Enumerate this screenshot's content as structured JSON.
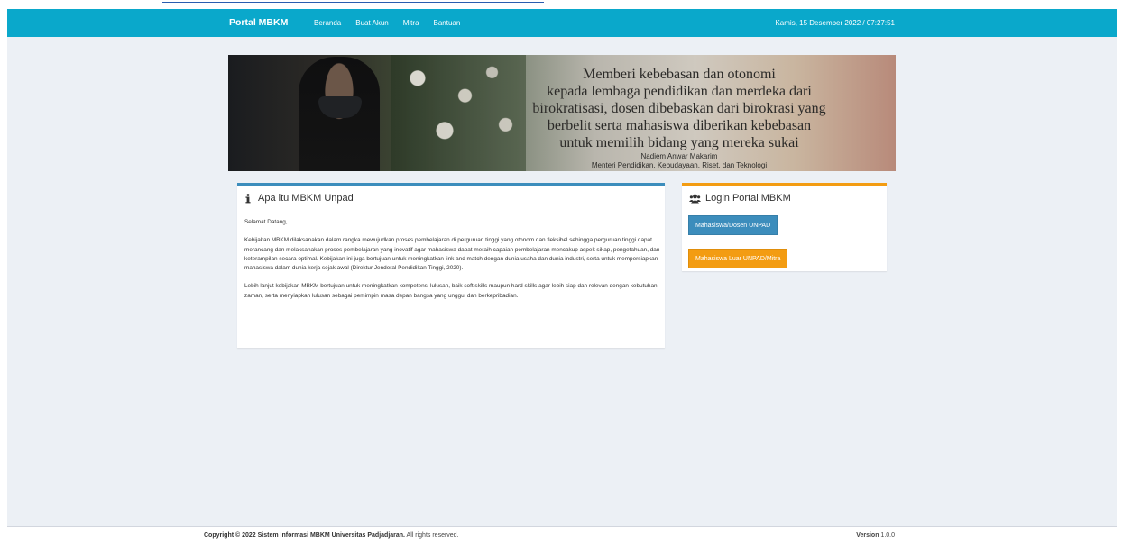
{
  "navbar": {
    "brand": "Portal MBKM",
    "links": [
      "Beranda",
      "Buat Akun",
      "Mitra",
      "Bantuan"
    ],
    "datetime": "Kamis, 15 Desember 2022 / 07:27:51"
  },
  "banner": {
    "quote_lines": [
      "Memberi kebebasan dan otonomi",
      "kepada lembaga pendidikan dan merdeka dari",
      "birokratisasi, dosen dibebaskan dari birokrasi yang",
      "berbelit serta mahasiswa diberikan kebebasan",
      "untuk memilih bidang yang mereka sukai"
    ],
    "author": "Nadiem Anwar Makarim",
    "role": "Menteri Pendidikan, Kebudayaan, Riset, dan Teknologi"
  },
  "info_card": {
    "title": "Apa itu MBKM Unpad",
    "greeting": "Selamat Datang,",
    "paragraph1": "Kebijakan MBKM dilaksanakan dalam rangka mewujudkan proses pembelajaran di perguruan tinggi yang otonom dan fleksibel sehingga perguruan tinggi dapat merancang dan melaksanakan proses pembelajaran yang inovatif agar mahasiswa dapat meraih capaian pembelajaran mencakup aspek sikap, pengetahuan, dan keterampilan secara optimal. Kebijakan ini juga bertujuan untuk meningkatkan link and match dengan dunia usaha dan dunia industri, serta untuk mempersiapkan mahasiswa dalam dunia kerja sejak awal (Direktur Jenderal Pendidikan Tinggi, 2020).",
    "paragraph2": "Lebih lanjut kebijakan MBKM bertujuan untuk meningkatkan kompetensi lulusan, baik soft skills maupun hard skills agar lebih siap dan relevan dengan kebutuhan zaman, serta menyiapkan lulusan sebagai pemimpin masa depan bangsa yang unggul dan berkepribadian."
  },
  "login_card": {
    "title": "Login Portal MBKM",
    "btn_internal": "Mahasiswa/Dosen UNPAD",
    "btn_external": "Mahasiswa Luar UNPAD/Mitra"
  },
  "footer": {
    "copyright_bold": "Copyright © 2022 Sistem Informasi MBKM Universitas Padjadjaran.",
    "copyright_rest": " All rights reserved.",
    "version_label": "Version",
    "version_value": " 1.0.0"
  },
  "colors": {
    "navbar": "#0aa8cb",
    "primary": "#3c8dbc",
    "warning": "#f39c12",
    "content_bg": "#ecf0f5"
  },
  "icons": {
    "info": "info-icon",
    "users": "users-icon"
  }
}
